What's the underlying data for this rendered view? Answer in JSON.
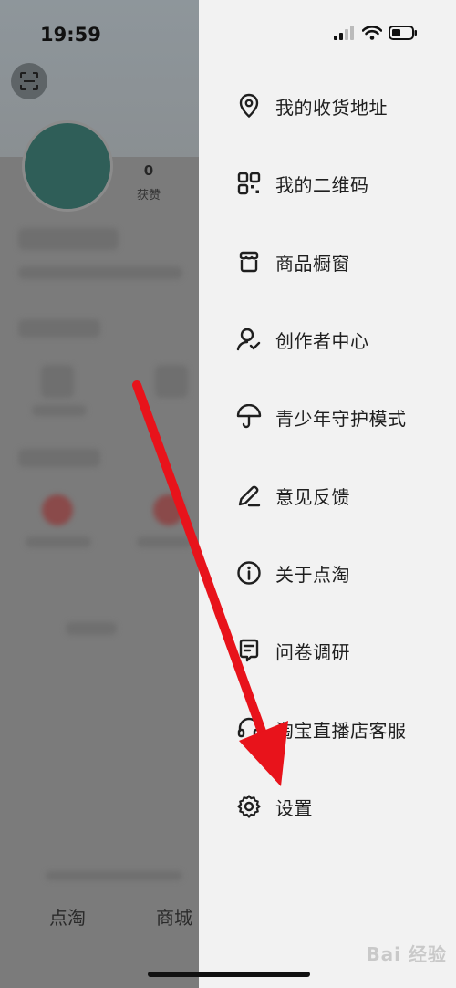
{
  "status_bar": {
    "time": "19:59"
  },
  "profile": {
    "likes_count": "0",
    "likes_label": "获赞"
  },
  "bottom_tabs": [
    "点淘",
    "商城"
  ],
  "drawer": {
    "items": [
      {
        "label": "我的收货地址",
        "icon": "location-pin-icon"
      },
      {
        "label": "我的二维码",
        "icon": "qr-code-icon"
      },
      {
        "label": "商品橱窗",
        "icon": "shop-window-icon"
      },
      {
        "label": "创作者中心",
        "icon": "creator-icon"
      },
      {
        "label": "青少年守护模式",
        "icon": "umbrella-icon"
      },
      {
        "label": "意见反馈",
        "icon": "pencil-icon"
      },
      {
        "label": "关于点淘",
        "icon": "info-icon"
      },
      {
        "label": "问卷调研",
        "icon": "survey-icon"
      },
      {
        "label": "淘宝直播店客服",
        "icon": "headset-icon"
      },
      {
        "label": "设置",
        "icon": "gear-icon"
      }
    ]
  },
  "annotation": {
    "arrow_color": "#e8131b"
  },
  "watermark": {
    "text": "Bai 经验"
  }
}
